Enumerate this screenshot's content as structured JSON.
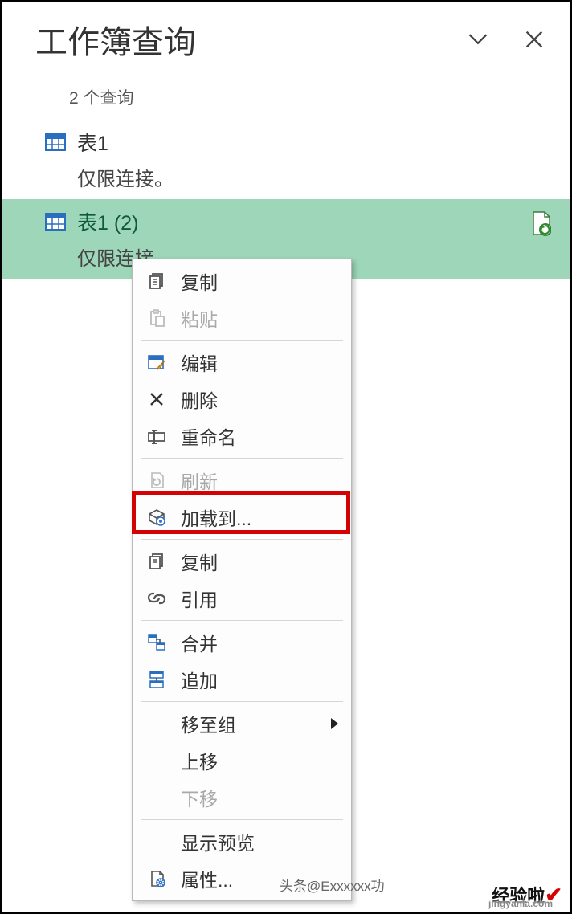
{
  "pane": {
    "title": "工作簿查询",
    "count_label": "2 个查询"
  },
  "queries": [
    {
      "name": "表1",
      "status": "仅限连接。"
    },
    {
      "name": "表1 (2)",
      "status": "仅限连接。"
    }
  ],
  "menu": {
    "copy": "复制",
    "paste": "粘贴",
    "edit": "编辑",
    "delete": "删除",
    "rename": "重命名",
    "refresh": "刷新",
    "load_to": "加载到...",
    "duplicate": "复制",
    "reference": "引用",
    "merge": "合并",
    "append": "追加",
    "move_to_group": "移至组",
    "move_up": "上移",
    "move_down": "下移",
    "show_preview": "显示预览",
    "properties": "属性..."
  },
  "footer": {
    "author": "头条@Exxxxxx功",
    "watermark": "经验啦",
    "watermark_url": "jingyanla.com"
  }
}
